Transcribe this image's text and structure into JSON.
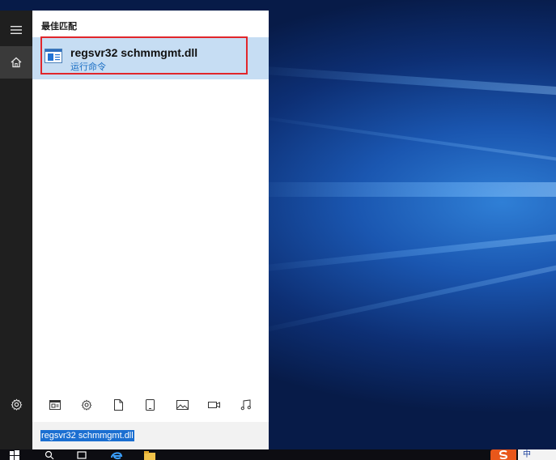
{
  "search": {
    "section_title": "最佳匹配",
    "best_match": {
      "title": "regsvr32 schmmgmt.dll",
      "subtitle": "运行命令",
      "icon": "run-command-icon"
    },
    "query": "regsvr32 schmmgmt.dll",
    "filters": [
      {
        "name": "apps-filter",
        "icon": "app-window-icon"
      },
      {
        "name": "settings-filter",
        "icon": "gear-icon"
      },
      {
        "name": "documents-filter",
        "icon": "document-icon"
      },
      {
        "name": "tablet-filter",
        "icon": "tablet-icon"
      },
      {
        "name": "photos-filter",
        "icon": "photo-icon"
      },
      {
        "name": "videos-filter",
        "icon": "video-icon"
      },
      {
        "name": "music-filter",
        "icon": "music-icon"
      }
    ]
  },
  "rail": {
    "items": [
      "hamburger-icon",
      "home-icon",
      "gear-icon"
    ]
  },
  "taskbar": {
    "tray_text": "中"
  },
  "colors": {
    "selection_bg": "#c6ddf3",
    "highlight_border": "#e1262b",
    "subtitle": "#1b6fc4",
    "query_selection": "#1b6fd1"
  }
}
